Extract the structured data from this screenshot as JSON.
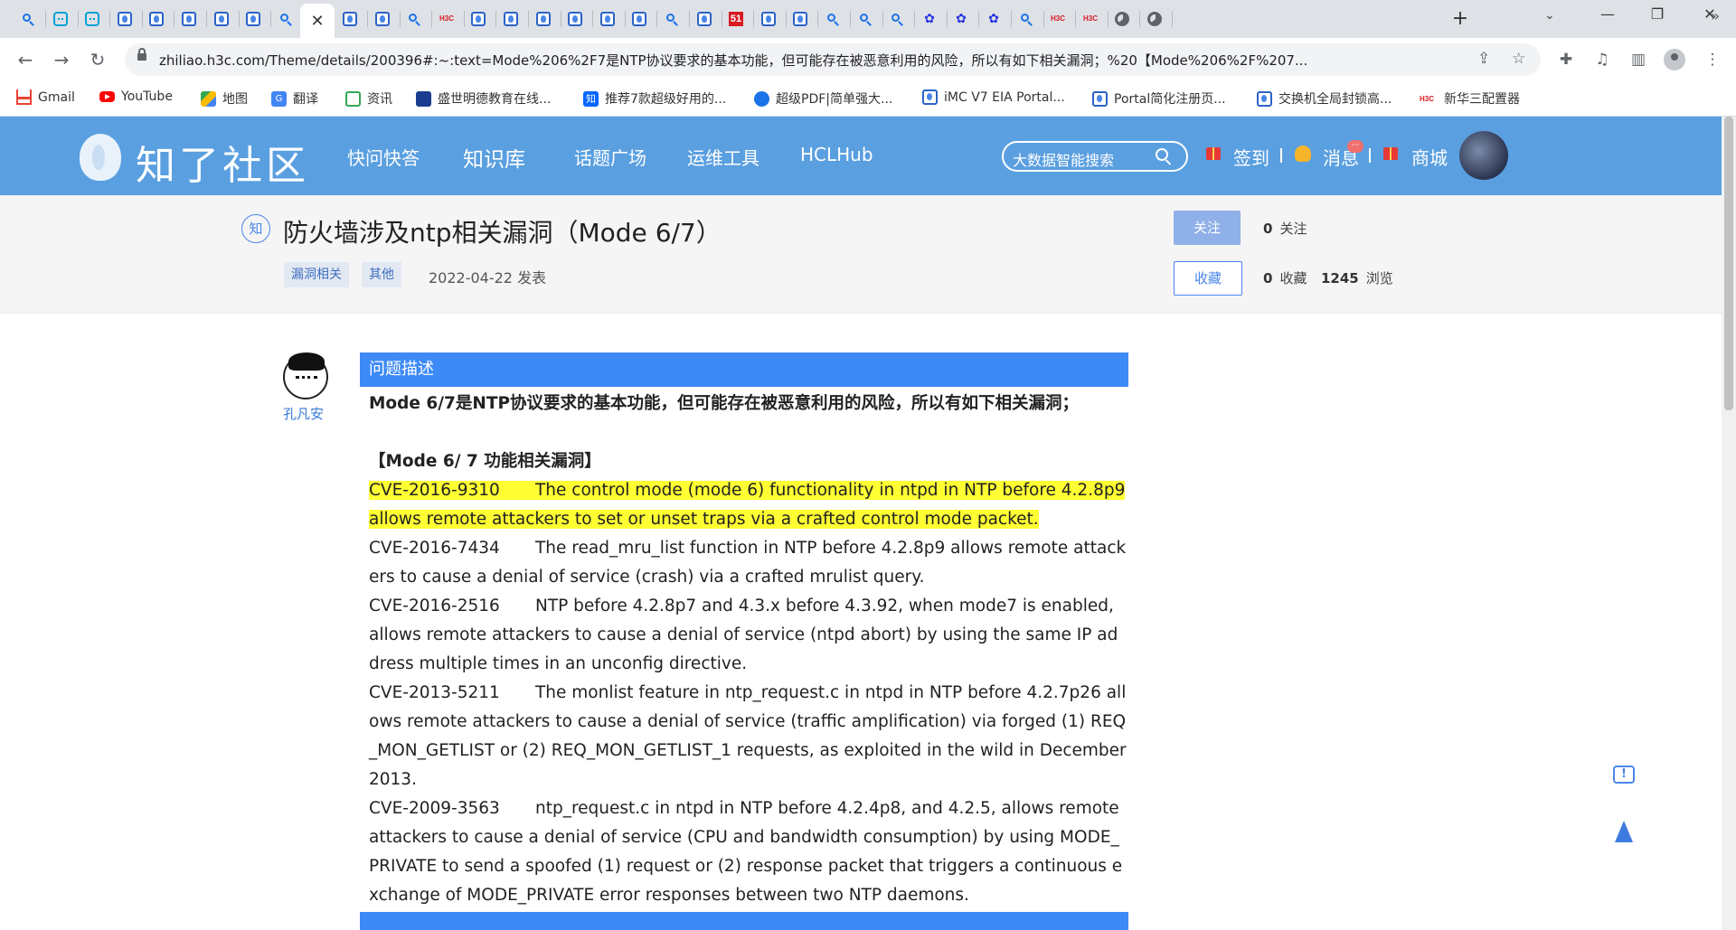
{
  "browser": {
    "active_tab_close": "✕",
    "new_tab": "+",
    "tabs": [
      {
        "icon": "search-icon"
      },
      {
        "icon": "bilibili-icon"
      },
      {
        "icon": "bilibili-icon"
      },
      {
        "icon": "zhiliao-icon"
      },
      {
        "icon": "zhiliao-icon"
      },
      {
        "icon": "zhiliao-icon"
      },
      {
        "icon": "zhiliao-icon"
      },
      {
        "icon": "zhiliao-icon"
      },
      {
        "icon": "search-icon"
      },
      {
        "icon": "close-icon",
        "active": true
      },
      {
        "icon": "zhiliao-icon"
      },
      {
        "icon": "zhiliao-icon"
      },
      {
        "icon": "search-icon"
      },
      {
        "icon": "h3c-icon"
      },
      {
        "icon": "zhiliao-icon"
      },
      {
        "icon": "zhiliao-icon"
      },
      {
        "icon": "zhiliao-icon"
      },
      {
        "icon": "zhiliao-icon"
      },
      {
        "icon": "zhiliao-icon"
      },
      {
        "icon": "zhiliao-icon"
      },
      {
        "icon": "search-icon"
      },
      {
        "icon": "zhiliao-icon"
      },
      {
        "icon": "site-51-icon"
      },
      {
        "icon": "zhiliao-icon"
      },
      {
        "icon": "zhiliao-icon"
      },
      {
        "icon": "search-icon"
      },
      {
        "icon": "search-icon"
      },
      {
        "icon": "search-icon"
      },
      {
        "icon": "baidu-icon"
      },
      {
        "icon": "baidu-icon"
      },
      {
        "icon": "baidu-icon"
      },
      {
        "icon": "search-icon"
      },
      {
        "icon": "h3c-icon"
      },
      {
        "icon": "h3c-icon"
      },
      {
        "icon": "globe-icon"
      },
      {
        "icon": "globe-icon"
      }
    ],
    "url": "zhiliao.h3c.com/Theme/details/200396#:~:text=Mode%206%2F7是NTP协议要求的基本功能，但可能存在被恶意利用的风险，所以有如下相关漏洞；%20【Mode%206%2F%207...",
    "bookmarks": [
      {
        "label": "Gmail",
        "icon": "gmail-icon"
      },
      {
        "label": "YouTube",
        "icon": "youtube-icon"
      },
      {
        "label": "地图",
        "icon": "maps-icon"
      },
      {
        "label": "翻译",
        "icon": "translate-icon"
      },
      {
        "label": "资讯",
        "icon": "news-icon"
      },
      {
        "label": "盛世明德教育在线...",
        "icon": "shengshi-icon"
      },
      {
        "label": "推荐7款超级好用的...",
        "icon": "zhihu-icon"
      },
      {
        "label": "超级PDF|简单强大...",
        "icon": "pdf-icon"
      },
      {
        "label": "iMC V7 EIA Portal...",
        "icon": "zhiliao-icon"
      },
      {
        "label": "Portal简化注册页...",
        "icon": "zhiliao-icon"
      },
      {
        "label": "交换机全局封锁高...",
        "icon": "zhiliao-icon"
      },
      {
        "label": "新华三配置器",
        "icon": "h3c-icon"
      }
    ],
    "bookmarks_more": "»"
  },
  "site": {
    "logo_text": "知了社区",
    "nav": [
      "快问快答",
      "知识库",
      "话题广场",
      "运维工具",
      "HCLHub"
    ],
    "search_placeholder": "大数据智能搜索",
    "checkin": "签到",
    "messages": "消息",
    "messages_badge": "···",
    "mall": "商城"
  },
  "post": {
    "badge": "知",
    "title": "防火墙涉及ntp相关漏洞（Mode 6/7）",
    "tags": [
      "漏洞相关",
      "其他"
    ],
    "date": "2022-04-22 发表",
    "follow_button": "关注",
    "favorite_button": "收藏",
    "follows_count": "0",
    "follows_label": "关注",
    "favorites_count": "0",
    "favorites_label": "收藏",
    "views_count": "1245",
    "views_label": "浏览",
    "author": "孔凡安"
  },
  "article": {
    "section_title": "问题描述",
    "intro": "Mode 6/7是NTP协议要求的基本功能，但可能存在被恶意利用的风险，所以有如下相关漏洞；",
    "heading": "【Mode 6/ 7  功能相关漏洞】",
    "cves": [
      {
        "id": "CVE-2016-9310",
        "text": "The control mode (mode 6) functionality in ntpd in NTP before 4.2.8p9 allows remote attackers to set or unset traps via a crafted control mode packet.",
        "highlight": true
      },
      {
        "id": "CVE-2016-7434",
        "text": "The read_mru_list function in NTP before 4.2.8p9 allows remote attackers to cause a denial of service (crash) via a crafted mrulist query.",
        "highlight": false
      },
      {
        "id": "CVE-2016-2516",
        "text": "NTP before 4.2.8p7 and 4.3.x before 4.3.92, when mode7 is enabled, allows remote attackers to cause a denial of service (ntpd abort) by using the same IP address multiple times in an unconfig directive.",
        "highlight": false
      },
      {
        "id": "CVE-2013-5211",
        "text": "The monlist feature in ntp_request.c in ntpd in NTP before 4.2.7p26 allows remote attackers to cause a denial of service (traffic amplification) via forged (1) REQ_MON_GETLIST or (2) REQ_MON_GETLIST_1 requests, as exploited in the wild in December 2013.",
        "highlight": false
      },
      {
        "id": "CVE-2009-3563",
        "text": "ntp_request.c in ntpd in NTP before 4.2.4p8, and 4.2.5, allows remote attackers to cause a denial of service (CPU and bandwidth consumption) by using MODE_PRIVATE to send a spoofed (1) request or (2) response packet that triggers a continuous exchange of MODE_PRIVATE error responses between two NTP daemons.",
        "highlight": false
      }
    ]
  },
  "colors": {
    "header_blue": "#5a9fe0",
    "section_blue": "#3d8af7",
    "highlight_yellow": "#ffff33"
  }
}
